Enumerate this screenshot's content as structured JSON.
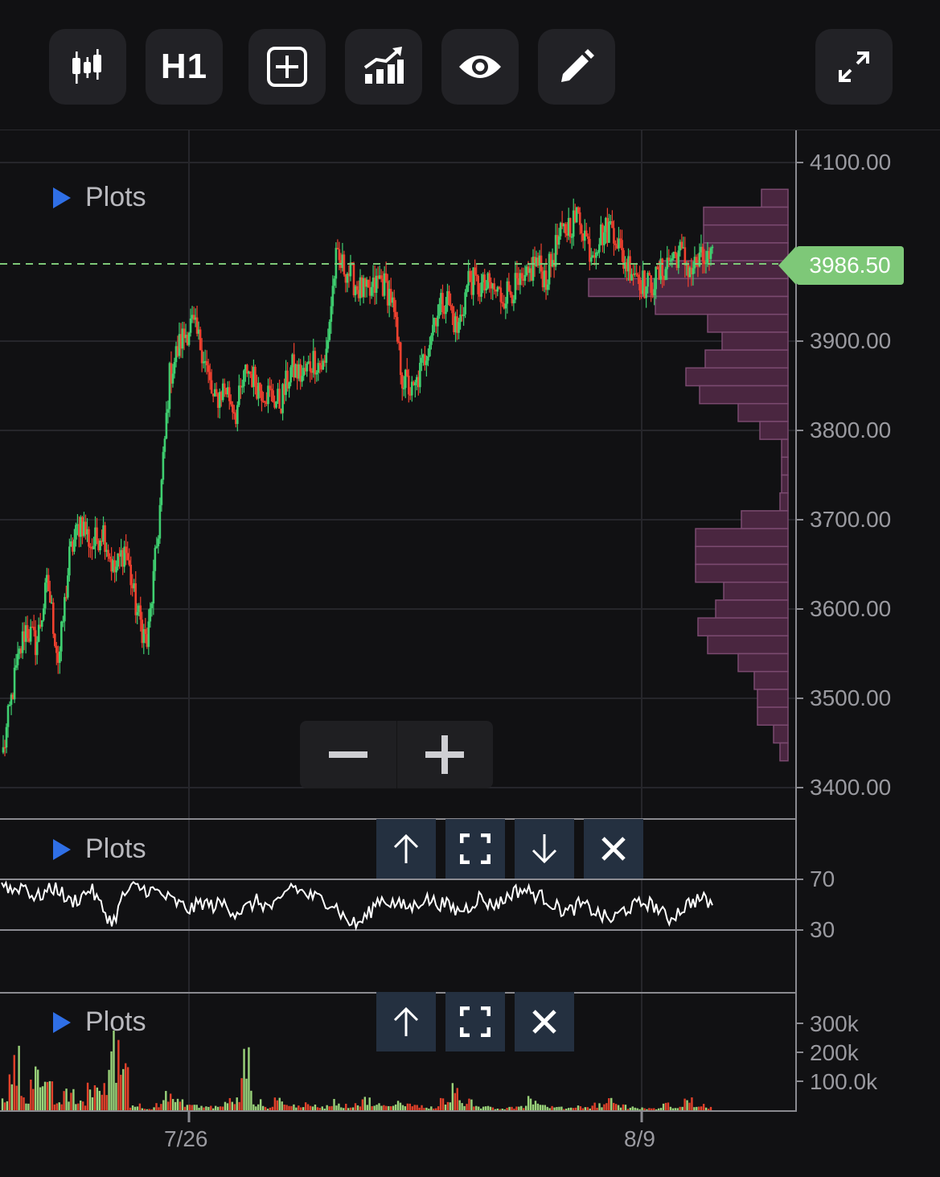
{
  "toolbar": {
    "items": [
      {
        "id": "candles",
        "icon": "candlestick-icon"
      },
      {
        "id": "timeframe",
        "label": "H1"
      },
      {
        "id": "add",
        "icon": "add-indicator-icon"
      },
      {
        "id": "indicators",
        "icon": "bar-trend-icon"
      },
      {
        "id": "visibility",
        "icon": "eye-icon"
      },
      {
        "id": "draw",
        "icon": "pencil-icon"
      },
      {
        "id": "fullscreen",
        "icon": "expand-icon"
      }
    ]
  },
  "panes": {
    "main": {
      "label": "Plots"
    },
    "oscillator": {
      "label": "Plots"
    },
    "volume": {
      "label": "Plots"
    }
  },
  "price_tag": "3986.50",
  "colors": {
    "up": "#3fcf70",
    "down": "#f0412f",
    "profile": "#4a2640",
    "profile_edge": "#7b4a70",
    "accent_tag": "#7ec878",
    "pane_ctl_bg": "#243040",
    "marker_blue": "#2f6fe6"
  },
  "chart_data": [
    {
      "type": "candlestick",
      "timeframe": "H1",
      "x_ticks": [
        "7/26",
        "8/9"
      ],
      "y_ticks": [
        "4100.00",
        "3900.00",
        "3800.00",
        "3700.00",
        "3600.00",
        "3500.00",
        "3400.00"
      ],
      "ylim": [
        3390,
        4120
      ],
      "last_price": 3986.5,
      "series": [
        {
          "anchors_close": [
            3440,
            3520,
            3580,
            3560,
            3630,
            3540,
            3660,
            3700,
            3670,
            3690,
            3640,
            3670,
            3600,
            3560,
            3690,
            3860,
            3900,
            3920,
            3890,
            3830,
            3850,
            3820,
            3870,
            3850,
            3840,
            3830,
            3870,
            3860,
            3880,
            3870,
            3990,
            3980,
            3960,
            3950,
            3970,
            3950,
            3860,
            3840,
            3880,
            3930,
            3950,
            3910,
            3970,
            3960,
            3960,
            3950,
            3960,
            3960,
            3990,
            3970,
            4010,
            4030,
            4040,
            4000,
            4020,
            4030,
            3990,
            3980,
            3960,
            3970,
            3990,
            4000,
            3980,
            3990,
            3990
          ]
        }
      ],
      "volume_profile": [
        {
          "from": 4050,
          "to": 4070,
          "volume": 33
        },
        {
          "from": 4030,
          "to": 4050,
          "volume": 105
        },
        {
          "from": 4010,
          "to": 4030,
          "volume": 105
        },
        {
          "from": 3990,
          "to": 4010,
          "volume": 105
        },
        {
          "from": 3970,
          "to": 3990,
          "volume": 160
        },
        {
          "from": 3950,
          "to": 3970,
          "volume": 248
        },
        {
          "from": 3930,
          "to": 3950,
          "volume": 165
        },
        {
          "from": 3910,
          "to": 3930,
          "volume": 100
        },
        {
          "from": 3890,
          "to": 3910,
          "volume": 82
        },
        {
          "from": 3870,
          "to": 3890,
          "volume": 103
        },
        {
          "from": 3850,
          "to": 3870,
          "volume": 127
        },
        {
          "from": 3830,
          "to": 3850,
          "volume": 110
        },
        {
          "from": 3810,
          "to": 3830,
          "volume": 62
        },
        {
          "from": 3790,
          "to": 3810,
          "volume": 35
        },
        {
          "from": 3770,
          "to": 3790,
          "volume": 8
        },
        {
          "from": 3750,
          "to": 3770,
          "volume": 8
        },
        {
          "from": 3730,
          "to": 3750,
          "volume": 8
        },
        {
          "from": 3710,
          "to": 3730,
          "volume": 10
        },
        {
          "from": 3690,
          "to": 3710,
          "volume": 58
        },
        {
          "from": 3670,
          "to": 3690,
          "volume": 115
        },
        {
          "from": 3650,
          "to": 3670,
          "volume": 115
        },
        {
          "from": 3630,
          "to": 3650,
          "volume": 115
        },
        {
          "from": 3610,
          "to": 3630,
          "volume": 80
        },
        {
          "from": 3590,
          "to": 3610,
          "volume": 90
        },
        {
          "from": 3570,
          "to": 3590,
          "volume": 112
        },
        {
          "from": 3550,
          "to": 3570,
          "volume": 100
        },
        {
          "from": 3530,
          "to": 3550,
          "volume": 62
        },
        {
          "from": 3510,
          "to": 3530,
          "volume": 42
        },
        {
          "from": 3490,
          "to": 3510,
          "volume": 38
        },
        {
          "from": 3470,
          "to": 3490,
          "volume": 38
        },
        {
          "from": 3450,
          "to": 3470,
          "volume": 18
        },
        {
          "from": 3430,
          "to": 3450,
          "volume": 10
        }
      ]
    },
    {
      "type": "line",
      "y_ticks": [
        "70",
        "30"
      ],
      "levels": [
        70,
        30
      ],
      "ylim": [
        0,
        100
      ],
      "series": [
        {
          "values": [
            68,
            61,
            66,
            55,
            60,
            64,
            52,
            55,
            63,
            48,
            35,
            58,
            64,
            62,
            60,
            55,
            50,
            46,
            52,
            49,
            51,
            44,
            47,
            53,
            48,
            50,
            66,
            60,
            56,
            54,
            50,
            38,
            34,
            42,
            55,
            52,
            49,
            48,
            55,
            52,
            50,
            45,
            48,
            56,
            50,
            52,
            60,
            62,
            58,
            55,
            48,
            44,
            50,
            47,
            41,
            38,
            46,
            49,
            52,
            48,
            38,
            45,
            52,
            55,
            50
          ]
        }
      ]
    },
    {
      "type": "bar",
      "y_ticks": [
        "300k",
        "200k",
        "100.0k"
      ],
      "ylim": [
        0,
        330000
      ],
      "series": [
        {
          "values": [
            52000,
            190000,
            60000,
            150000,
            82000,
            34000,
            61000,
            35000,
            95000,
            78000,
            240000,
            180000,
            21000,
            8000,
            28000,
            56000,
            32000,
            22000,
            16000,
            14000,
            26000,
            38000,
            184000,
            31000,
            14000,
            44000,
            18000,
            22000,
            17000,
            15000,
            35000,
            18000,
            26000,
            40000,
            21000,
            14000,
            38000,
            22000,
            15000,
            12000,
            40000,
            76000,
            33000,
            12000,
            16000,
            8000,
            14000,
            21000,
            46000,
            18000,
            12000,
            10000,
            16000,
            14000,
            24000,
            38000,
            20000,
            11000,
            8000,
            6000,
            22000,
            14000,
            38000,
            19000,
            12000
          ]
        }
      ]
    }
  ]
}
